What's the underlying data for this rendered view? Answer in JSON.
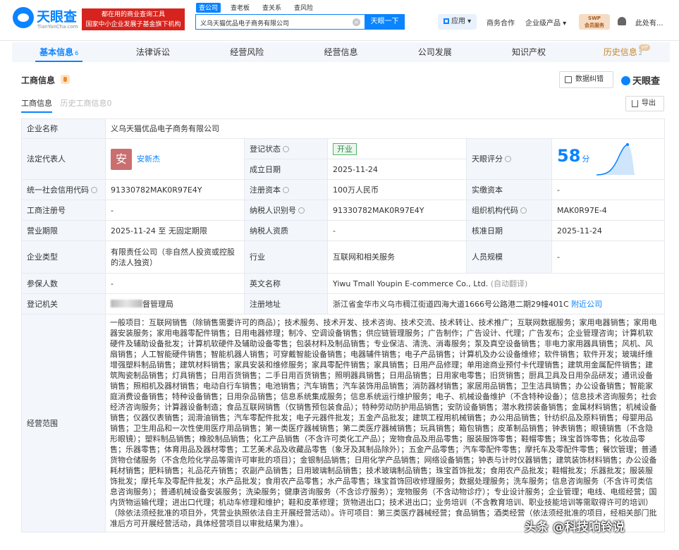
{
  "header": {
    "logo_name": "天眼查",
    "logo_domain": "TianYanCha.com",
    "slogan_line1": "都在用的商业查询工具",
    "slogan_line2": "国家中小企业发展子基金旗下机构",
    "search_tabs": [
      "查公司",
      "查老板",
      "查关系",
      "查风险"
    ],
    "search_value": "义乌天猫优品电子商务有限公司",
    "search_button": "天眼一下",
    "apps_label": "应用",
    "nav_business": "商务合作",
    "nav_enterprise": "企业级产品",
    "swp_line1": "SWP",
    "swp_line2": "会员服务",
    "user_label": "此处有..."
  },
  "main_tabs": [
    {
      "label": "基本信息",
      "count": "6"
    },
    {
      "label": "法律诉讼",
      "count": ""
    },
    {
      "label": "经营风险",
      "count": ""
    },
    {
      "label": "经营信息",
      "count": ""
    },
    {
      "label": "公司发展",
      "count": ""
    },
    {
      "label": "知识产权",
      "count": ""
    },
    {
      "label": "历史信息",
      "count": "2",
      "badge": "VIP"
    }
  ],
  "section": {
    "title": "工商信息",
    "correct_button": "数据纠错",
    "brand": "天眼查",
    "sub_tabs": [
      "工商信息",
      "历史工商信息0"
    ],
    "export_button": "导出"
  },
  "company": {
    "name_label": "企业名称",
    "name": "义乌天猫优品电子商务有限公司",
    "legal_label": "法定代表人",
    "legal_avatar": "安",
    "legal_name": "安新杰",
    "reg_status_label": "登记状态",
    "reg_status": "开业",
    "setup_date_label": "成立日期",
    "setup_date": "2025-11-24",
    "score_label": "天眼评分",
    "score": "58",
    "score_unit": "分",
    "credit_code_label": "统一社会信用代码",
    "credit_code": "91330782MAK0R97E4Y",
    "reg_capital_label": "注册资本",
    "reg_capital": "100万人民币",
    "paid_capital_label": "实缴资本",
    "paid_capital": "-",
    "reg_no_label": "工商注册号",
    "reg_no": "-",
    "taxpayer_id_label": "纳税人识别号",
    "taxpayer_id": "91330782MAK0R97E4Y",
    "org_code_label": "组织机构代码",
    "org_code": "MAK0R97E-4",
    "term_label": "营业期限",
    "term": "2025-11-24 至 无固定期限",
    "taxpayer_qual_label": "纳税人资质",
    "taxpayer_qual": "-",
    "approve_date_label": "核准日期",
    "approve_date": "2025-11-24",
    "type_label": "企业类型",
    "type": "有限责任公司（非自然人投资或控股的法人独资）",
    "industry_label": "行业",
    "industry": "互联网和相关服务",
    "staff_label": "人员规模",
    "staff": "-",
    "insured_label": "参保人数",
    "insured": "-",
    "en_name_label": "英文名称",
    "en_name": "Yiwu Tmall Youpin E-commerce Co., Ltd.",
    "en_name_note": "(自动翻译)",
    "authority_label": "登记机关",
    "authority_suffix": "督管理局",
    "address_label": "注册地址",
    "address": "浙江省金华市义乌市稠江街道四海大道1666号公路港二期29幢401C",
    "nearby_link": "附近公司",
    "scope_label": "经营范围",
    "scope": "一般项目：互联网销售（除销售需要许可的商品）；技术服务、技术开发、技术咨询、技术交流、技术转让、技术推广；互联网数据服务；家用电器销售；家用电器安装服务；家用电器零配件销售；日用电器修理；制冷、空调设备销售；供应链管理服务；广告制作；广告设计、代理；广告发布；企业管理咨询；计算机软硬件及辅助设备批发；计算机软硬件及辅助设备零售；包装材料及制品销售；专业保洁、清洗、消毒服务；泵及真空设备销售；非电力家用器具销售；风机、风扇销售；人工智能硬件销售；智能机器人销售；可穿戴智能设备销售；电器辅件销售；电子产品销售；计算机及办公设备维修；软件销售；软件开发；玻璃纤维增强塑料制品销售；建筑材料销售；家具安装和维修服务；家具零配件销售；家具销售；日用产品修理；单用途商业预付卡代理销售；建筑用金属配件销售；建筑陶瓷制品销售；灯具销售；日用百货销售；二手日用百货销售；照明器具销售；日用品销售；日用家电零售；旧货销售；厨具卫具及日用杂品研发；通讯设备销售；照相机及器材销售；电动自行车销售；电池销售；汽车销售；汽车装饰用品销售；消防器材销售；家居用品销售；卫生洁具销售；办公设备销售；智能家庭消费设备销售；特种设备销售；日用杂品销售；信息系统集成服务；信息系统运行维护服务；电子、机械设备维护（不含特种设备）；信息技术咨询服务；社会经济咨询服务；计算器设备制造；食品互联网销售（仅销售预包装食品）；特种劳动防护用品销售；安防设备销售；潜水救捞装备销售；金属材料销售；机械设备销售；仪器仪表销售；润滑油销售；汽车零配件批发；电子元器件批发；五金产品批发；建筑工程用机械销售；办公用品销售；针纺织品及原料销售；母婴用品销售；卫生用品和一次性使用医疗用品销售；第一类医疗器械销售；第二类医疗器械销售；玩具销售；箱包销售；皮革制品销售；钟表销售；眼镜销售（不含隐形眼镜）；塑料制品销售；橡胶制品销售；化工产品销售（不含许可类化工产品）；宠物食品及用品零售；服装服饰零售；鞋帽零售；珠宝首饰零售；化妆品零售；乐器零售；体育用品及器材零售；工艺美术品及收藏品零售（象牙及其制品除外）；五金产品零售；汽车零配件零售；摩托车及零配件零售；餐饮管理；普通货物仓储服务（不含危险化学品等需许可审批的项目）；金银制品销售；日用化学产品销售；网络设备销售；钟表与计时仪器销售；建筑装饰材料销售；办公设备耗材销售；肥料销售；礼品花卉销售；农副产品销售；日用玻璃制品销售；技术玻璃制品销售；珠宝首饰批发；食用农产品批发；鞋帽批发；乐器批发；服装服饰批发；摩托车及零配件批发；水产品批发；食用农产品零售；水产品零售；珠宝首饰回收修理服务；数据处理服务；洗车服务；信息咨询服务（不含许可类信息咨询服务）；普通机械设备安装服务；洗染服务；健康咨询服务（不含诊疗服务）；宠物服务（不含动物诊疗）；专业设计服务；企业管理；电线、电缆经营；国内货物运输代理；进出口代理；机动车修理和维护；鞋和皮革修理；货物进出口；技术进出口；业务培训（不含教育培训、职业技能培训等需取得许可的培训）（除依法须经批准的项目外，凭营业执照依法自主开展经营活动）。许可项目：第三类医疗器械经营；食品销售；酒类经营（依法须经批准的项目，经相关部门批准后方可开展经营活动，具体经营项目以审批结果为准）。"
  },
  "watermark": "头条 @科技响铃说",
  "colors": {
    "accent": "#0a84ff",
    "status_green": "#2e8b48",
    "slogan_red": "#d7231d",
    "vip_gold": "#c8852a"
  }
}
